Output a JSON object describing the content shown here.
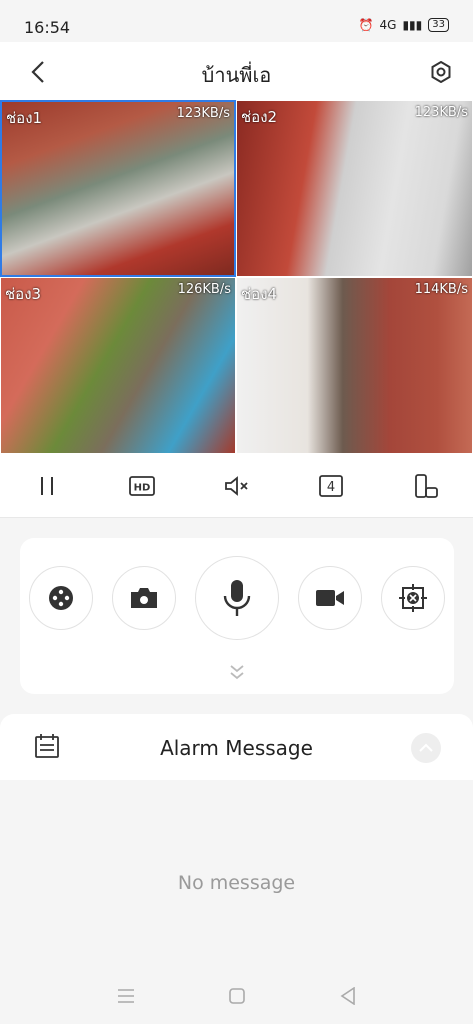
{
  "status": {
    "time": "16:54",
    "network": "4G",
    "battery": "33"
  },
  "header": {
    "title": "บ้านพี่เอ"
  },
  "channels": [
    {
      "label": "ช่อง1",
      "rate": "123KB/s"
    },
    {
      "label": "ช่อง2",
      "rate": "123KB/s"
    },
    {
      "label": "ช่อง3",
      "rate": "126KB/s"
    },
    {
      "label": "ช่อง4",
      "rate": "114KB/s"
    }
  ],
  "controls": {
    "split_count": "4",
    "quality": "HD"
  },
  "alarm": {
    "title": "Alarm Message",
    "empty_text": "No message"
  },
  "colors": {
    "accent": "#2f7be6",
    "icon": "#333333"
  }
}
